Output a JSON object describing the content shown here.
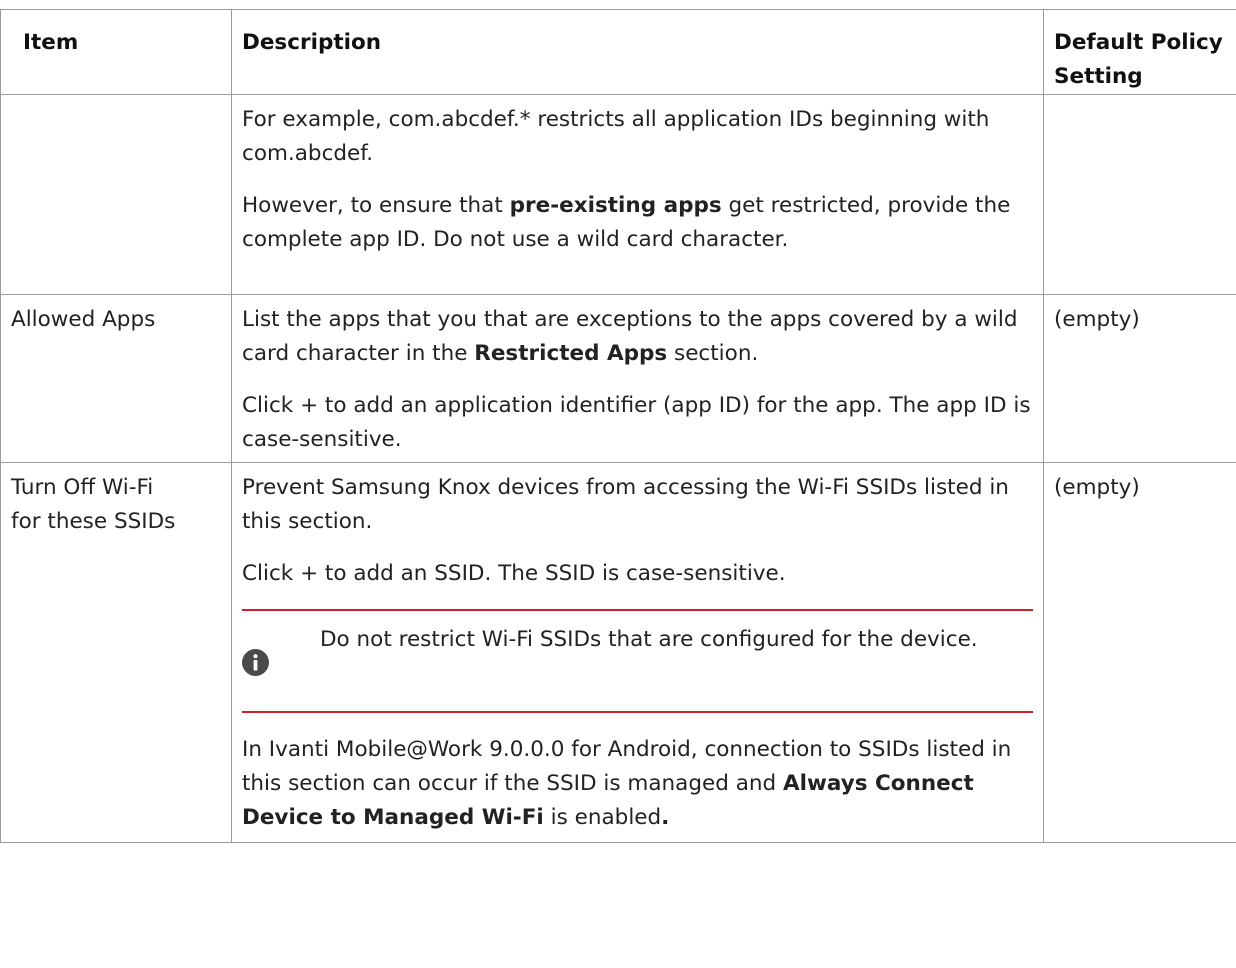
{
  "table": {
    "headers": {
      "item": "Item",
      "description": "Description",
      "default_line1": "Default Policy",
      "default_line2": "Setting"
    },
    "rows": [
      {
        "item": "",
        "description": {
          "p1": "For example, com.abcdef.* restricts all application IDs beginning with com.abcdef.",
          "p2_before": "However, to ensure that ",
          "p2_bold": "pre-existing apps",
          "p2_after": " get restricted, provide the complete app ID. Do not use a wild card character."
        },
        "default": ""
      },
      {
        "item": "Allowed Apps",
        "description": {
          "p1_before": "List the apps that you that are exceptions to the apps covered by a wild card character in the ",
          "p1_bold": "Restricted Apps",
          "p1_after": " section.",
          "p2": "Click + to add an application identifier (app ID) for the app. The app ID is case-sensitive."
        },
        "default": "(empty)"
      },
      {
        "item_line1": "Turn Off Wi-Fi",
        "item_line2": "for these SSIDs",
        "description": {
          "p1": "Prevent Samsung Knox devices from accessing the Wi-Fi SSIDs listed in this section.",
          "p2": "Click + to add an SSID. The SSID is case-sensitive.",
          "note": {
            "icon": "info-icon",
            "text": "Do not restrict Wi-Fi SSIDs that are configured for the device."
          },
          "p3_before": "In Ivanti Mobile@Work 9.0.0.0 for Android, connection to SSIDs listed in this section can occur if the SSID is managed and ",
          "p3_bold": "Always Connect Device to Managed Wi-Fi",
          "p3_mid": " is enabled",
          "p3_bold_end": "."
        },
        "default": "(empty)"
      }
    ]
  },
  "colors": {
    "border": "#9a9a9a",
    "note_rule": "#d0202a",
    "icon_bg": "#4a4a4a",
    "text": "#222222"
  }
}
